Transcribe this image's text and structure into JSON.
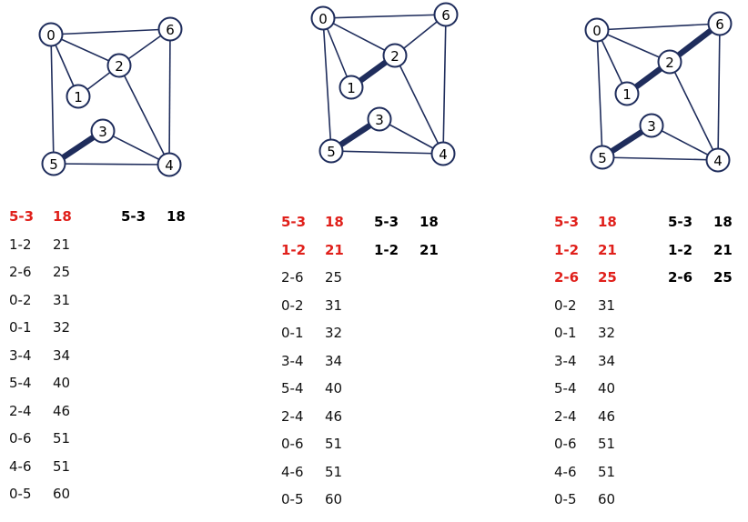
{
  "colors": {
    "edge": "#1f2d5c",
    "selected_text": "#e0201b"
  },
  "node_labels": [
    "0",
    "1",
    "2",
    "3",
    "4",
    "5",
    "6"
  ],
  "edges": [
    [
      "0",
      "6"
    ],
    [
      "0",
      "2"
    ],
    [
      "0",
      "1"
    ],
    [
      "0",
      "5"
    ],
    [
      "1",
      "2"
    ],
    [
      "2",
      "6"
    ],
    [
      "2",
      "4"
    ],
    [
      "3",
      "5"
    ],
    [
      "3",
      "4"
    ],
    [
      "4",
      "5"
    ],
    [
      "4",
      "6"
    ]
  ],
  "steps": [
    {
      "mst_edges": [
        [
          "5",
          "3"
        ]
      ],
      "sorted_edges": [
        {
          "pair": "5-3",
          "weight": "18",
          "selected": true
        },
        {
          "pair": "1-2",
          "weight": "21",
          "selected": false
        },
        {
          "pair": "2-6",
          "weight": "25",
          "selected": false
        },
        {
          "pair": "0-2",
          "weight": "31",
          "selected": false
        },
        {
          "pair": "0-1",
          "weight": "32",
          "selected": false
        },
        {
          "pair": "3-4",
          "weight": "34",
          "selected": false
        },
        {
          "pair": "5-4",
          "weight": "40",
          "selected": false
        },
        {
          "pair": "2-4",
          "weight": "46",
          "selected": false
        },
        {
          "pair": "0-6",
          "weight": "51",
          "selected": false
        },
        {
          "pair": "4-6",
          "weight": "51",
          "selected": false
        },
        {
          "pair": "0-5",
          "weight": "60",
          "selected": false
        }
      ],
      "mst_list": [
        {
          "pair": "5-3",
          "weight": "18"
        }
      ]
    },
    {
      "mst_edges": [
        [
          "5",
          "3"
        ],
        [
          "1",
          "2"
        ]
      ],
      "sorted_edges": [
        {
          "pair": "5-3",
          "weight": "18",
          "selected": true
        },
        {
          "pair": "1-2",
          "weight": "21",
          "selected": true
        },
        {
          "pair": "2-6",
          "weight": "25",
          "selected": false
        },
        {
          "pair": "0-2",
          "weight": "31",
          "selected": false
        },
        {
          "pair": "0-1",
          "weight": "32",
          "selected": false
        },
        {
          "pair": "3-4",
          "weight": "34",
          "selected": false
        },
        {
          "pair": "5-4",
          "weight": "40",
          "selected": false
        },
        {
          "pair": "2-4",
          "weight": "46",
          "selected": false
        },
        {
          "pair": "0-6",
          "weight": "51",
          "selected": false
        },
        {
          "pair": "4-6",
          "weight": "51",
          "selected": false
        },
        {
          "pair": "0-5",
          "weight": "60",
          "selected": false
        }
      ],
      "mst_list": [
        {
          "pair": "5-3",
          "weight": "18"
        },
        {
          "pair": "1-2",
          "weight": "21"
        }
      ]
    },
    {
      "mst_edges": [
        [
          "5",
          "3"
        ],
        [
          "1",
          "2"
        ],
        [
          "2",
          "6"
        ]
      ],
      "sorted_edges": [
        {
          "pair": "5-3",
          "weight": "18",
          "selected": true
        },
        {
          "pair": "1-2",
          "weight": "21",
          "selected": true
        },
        {
          "pair": "2-6",
          "weight": "25",
          "selected": true
        },
        {
          "pair": "0-2",
          "weight": "31",
          "selected": false
        },
        {
          "pair": "0-1",
          "weight": "32",
          "selected": false
        },
        {
          "pair": "3-4",
          "weight": "34",
          "selected": false
        },
        {
          "pair": "5-4",
          "weight": "40",
          "selected": false
        },
        {
          "pair": "2-4",
          "weight": "46",
          "selected": false
        },
        {
          "pair": "0-6",
          "weight": "51",
          "selected": false
        },
        {
          "pair": "4-6",
          "weight": "51",
          "selected": false
        },
        {
          "pair": "0-5",
          "weight": "60",
          "selected": false
        }
      ],
      "mst_list": [
        {
          "pair": "5-3",
          "weight": "18"
        },
        {
          "pair": "1-2",
          "weight": "21"
        },
        {
          "pair": "2-6",
          "weight": "25"
        }
      ]
    }
  ]
}
